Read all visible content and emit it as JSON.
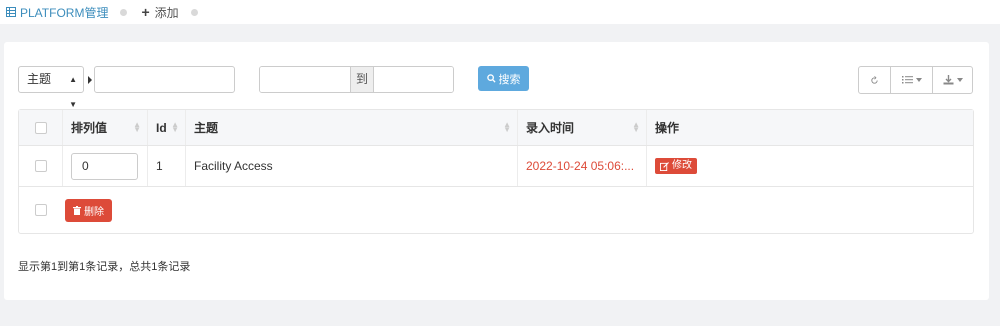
{
  "nav": {
    "tabs": [
      {
        "label": "PLATFORM管理",
        "icon": "grid-icon"
      },
      {
        "label": "添加",
        "icon": "plus-icon"
      }
    ]
  },
  "filters": {
    "field_select": "主题",
    "field_value": "",
    "range_from": "",
    "range_separator": "到",
    "range_to": "",
    "search_label": "搜索"
  },
  "toolbar": {
    "refresh_icon": "refresh-icon",
    "columns_icon": "list-icon",
    "export_icon": "download-icon"
  },
  "table": {
    "headers": [
      "排列值",
      "Id",
      "主题",
      "录入时间",
      "操作"
    ],
    "rows": [
      {
        "order": "0",
        "id": "1",
        "subject": "Facility Access",
        "time": "2022-10-24 05:06:...",
        "action": "修改"
      }
    ],
    "delete_label": "删除"
  },
  "summary": "显示第1到第1条记录，总共1条记录",
  "colors": {
    "primary": "#3c8dbc",
    "search": "#5ea9de",
    "danger": "#dd4b39"
  }
}
